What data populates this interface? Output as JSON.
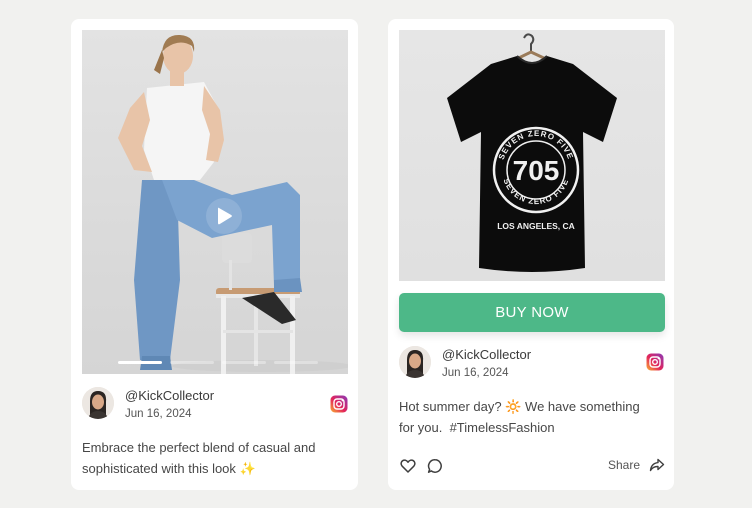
{
  "posts": [
    {
      "media_type": "video",
      "play_icon": "play-icon",
      "progress_segments": 4,
      "active_segment": 1,
      "author": {
        "handle": "@KickCollector",
        "date": "Jun 16, 2024",
        "network_icon": "instagram-icon"
      },
      "caption": {
        "text": "Embrace the perfect blend of casual and sophisticated with this look",
        "emoji": "✨"
      }
    },
    {
      "media_type": "image",
      "product_print": {
        "top_arc": "SEVEN ZERO FIVE",
        "number": "705",
        "bottom_arc": "SEVEN ZERO FIVE",
        "city": "LOS ANGELES, CA"
      },
      "buy_button": {
        "label": "BUY NOW",
        "color": "#4db888"
      },
      "author": {
        "handle": "@KickCollector",
        "date": "Jun 16, 2024",
        "network_icon": "instagram-icon"
      },
      "caption": {
        "line1": "Hot summer day?",
        "emoji": "🔆",
        "line1_rest": "We have something",
        "line2": "for you.  #TimelessFashion"
      },
      "actions": {
        "like_icon": "heart-icon",
        "comment_icon": "comment-icon",
        "share_label": "Share",
        "share_icon": "share-arrow-icon"
      }
    }
  ],
  "colors": {
    "background": "#f1f1ef",
    "card": "#ffffff",
    "accent": "#4db888"
  }
}
